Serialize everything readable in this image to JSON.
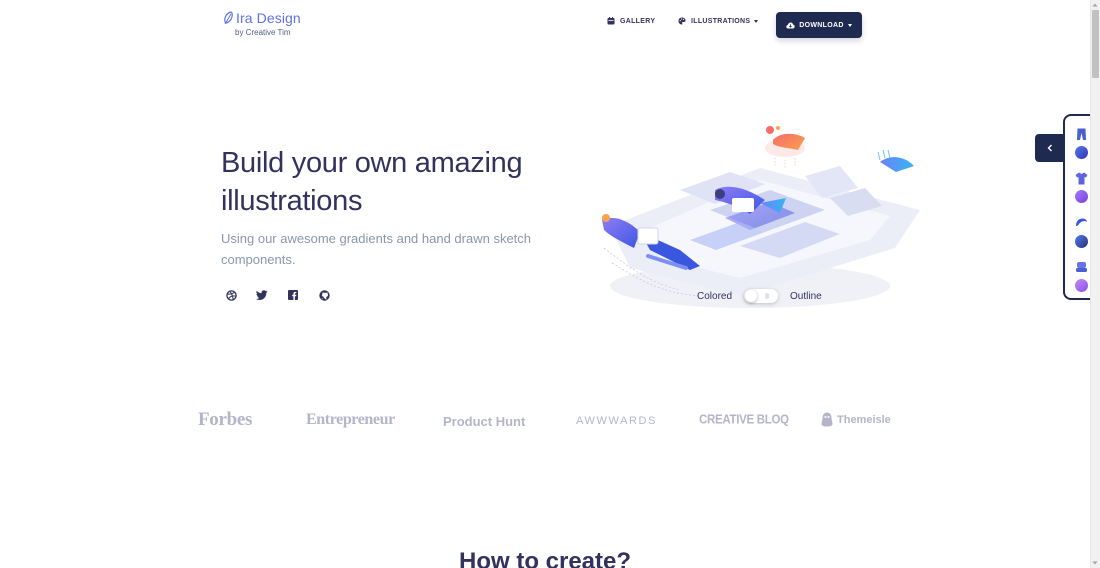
{
  "brand": {
    "name": "Ira Design",
    "sub": "by Creative Tim"
  },
  "nav": {
    "gallery": "GALLERY",
    "illustrations": "ILLUSTRATIONS",
    "download": "DOWNLOAD"
  },
  "hero": {
    "title": "Build your own amazing illustrations",
    "lead": "Using our awesome gradients and hand drawn sketch components."
  },
  "socials": [
    "dribbble-icon",
    "twitter-icon",
    "facebook-icon",
    "github-icon"
  ],
  "toggle": {
    "left_label": "Colored",
    "right_label": "Outline",
    "checked": false
  },
  "logos": {
    "forbes": "Forbes",
    "entrepreneur": "Entrepreneur",
    "producthunt": "Product Hunt",
    "awwwards": "AWWWARDS",
    "creativebloq": "CREATIVE BLOQ",
    "themeisle": "Themeisle"
  },
  "section": {
    "title": "How to create?"
  },
  "colors": {
    "primary": "#5e72e4",
    "dark": "#1e2a4f",
    "text": "#32325d",
    "muted": "#8898aa",
    "logo_gray": "#b3b6c9"
  }
}
